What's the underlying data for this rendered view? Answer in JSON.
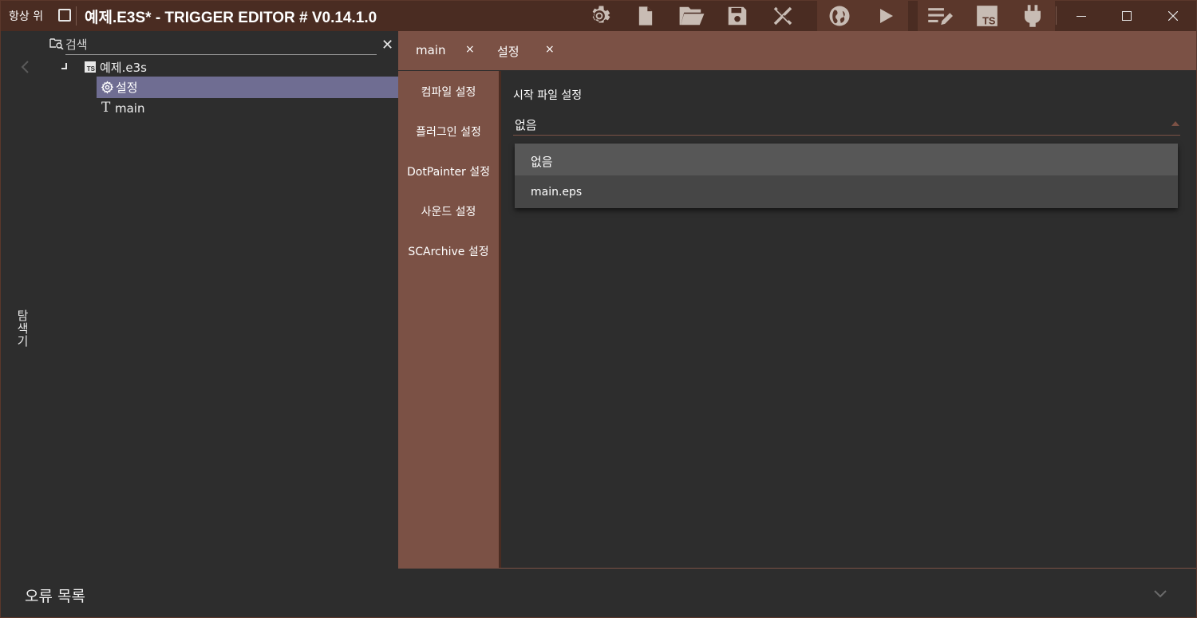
{
  "titlebar": {
    "always_on_top_label": "항상 위",
    "always_on_top_checked": false,
    "app_title": "예제.E3S* - TRIGGER EDITOR # V0.14.1.0",
    "toolbar_icons": [
      "gear-icon",
      "new-file-icon",
      "open-folder-icon",
      "save-icon",
      "tools-icon",
      "globe-icon",
      "play-icon",
      "edit-list-icon",
      "typescript-icon",
      "plug-icon"
    ],
    "window_controls": [
      "minimize-icon",
      "maximize-icon",
      "close-icon"
    ],
    "colors": {
      "bar": "#4a2c22",
      "group": "#5b372b",
      "icon": "#c8bcb4"
    }
  },
  "explorer": {
    "search_placeholder": "검색",
    "vertical_label": "탐색기",
    "tree": {
      "file_icon_text": "TS",
      "file_label": "예제.e3s",
      "settings_label": "설정",
      "main_label": "main"
    },
    "selection_color": "#6f6d92"
  },
  "tabs": [
    {
      "label": "main",
      "close": "×"
    },
    {
      "label": "설정",
      "close": "×"
    }
  ],
  "settings_nav": [
    "컴파일 설정",
    "플러그인 설정",
    "DotPainter 설정",
    "사운드 설정",
    "SCArchive 설정"
  ],
  "content": {
    "start_file_label": "시작 파일 설정",
    "combo_value": "없음",
    "dropdown_options": [
      "없음",
      "main.eps"
    ]
  },
  "error_panel": {
    "label": "오류 목록"
  },
  "accent_color": "#7b5145"
}
